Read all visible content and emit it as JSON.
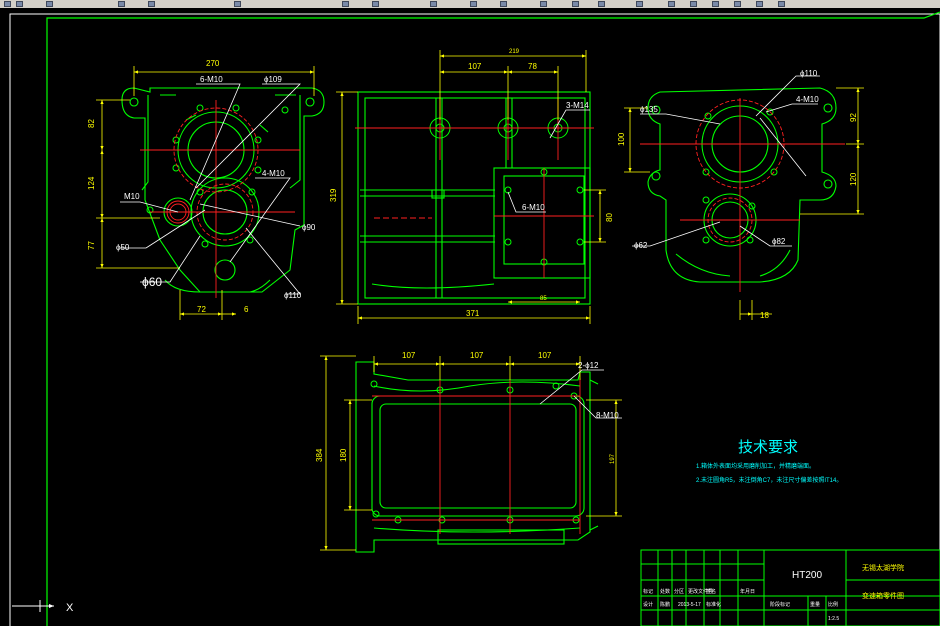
{
  "colors": {
    "background": "#000000",
    "outline": "#00ff00",
    "dimension": "#ffff00",
    "center_line": "#ff2020",
    "leader": "#ffffff",
    "title_block": "#00ff00",
    "notes": "#00ffff",
    "toolbar": "#d4d0c8"
  },
  "front_view": {
    "dims": {
      "d270": "270",
      "d82": "82",
      "d124": "124",
      "d77": "77",
      "d72": "72",
      "d6": "6"
    },
    "callouts": {
      "n6m10": "6-M10",
      "phi109": "ϕ109",
      "m10": "M10",
      "n4m10": "4-M10",
      "phi90": "ϕ90",
      "phi50": "ϕ50",
      "phi60": "ϕ60",
      "phi110": "ϕ110"
    }
  },
  "side_view": {
    "dims": {
      "d219": "219",
      "d107": "107",
      "d78": "78",
      "d319": "319",
      "d80": "80",
      "d85": "85",
      "d371": "371"
    },
    "callouts": {
      "n3m14": "3-M14",
      "n6m10": "6-M10"
    }
  },
  "right_view": {
    "dims": {
      "d100": "100",
      "d92": "92",
      "d120": "120",
      "d18": "18"
    },
    "callouts": {
      "phi110": "ϕ110",
      "phi135": "ϕ135",
      "n4m10": "4-M10",
      "phi62": "ϕ62",
      "phi82": "ϕ82"
    }
  },
  "top_view": {
    "dims": {
      "d107a": "107",
      "d107b": "107",
      "d107c": "107",
      "d384": "384",
      "d180": "180",
      "d197": "197"
    },
    "callouts": {
      "n2phi12": "2-ϕ12",
      "n8m10": "8-M10"
    }
  },
  "notes": {
    "title": "技术要求",
    "line1": "1.箱体外表面均采用磨削加工，并精磨端面。",
    "line2": "2.未注圆角R5，未注倒角C7，未注尺寸偏差按照IT14。"
  },
  "title_block": {
    "material": "HT200",
    "school": "无锡太湖学院",
    "drawing_title": "变速箱零件图",
    "row_labels": [
      "标记",
      "处数",
      "分区",
      "更改文件号",
      "签名",
      "年月日"
    ],
    "signoff": [
      "设计",
      "陈鹏",
      "2013-5-17",
      "标准化"
    ],
    "stage_label": "阶段标记",
    "weight_label": "重量",
    "scale_label": "比例",
    "scale": "1:2.5"
  },
  "ucs": {
    "x": "X"
  }
}
